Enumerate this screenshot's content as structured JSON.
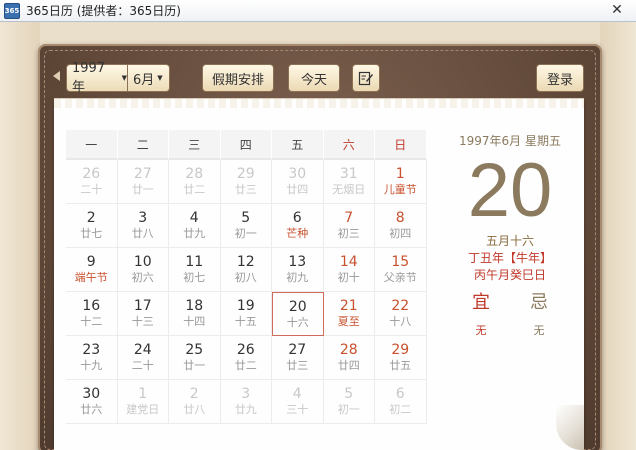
{
  "window": {
    "title": "365日历 (提供者：365日历)",
    "icon_text": "365",
    "close_glyph": "✕"
  },
  "toolbar": {
    "year": "1997 年",
    "month": "6月",
    "holiday_label": "假期安排",
    "today_label": "今天",
    "login_label": "登录"
  },
  "weekdays": [
    "一",
    "二",
    "三",
    "四",
    "五",
    "六",
    "日"
  ],
  "calendar": [
    [
      {
        "day": "26",
        "lunar": "二十"
      },
      {
        "day": "27",
        "lunar": "廿一"
      },
      {
        "day": "28",
        "lunar": "廿二"
      },
      {
        "day": "29",
        "lunar": "廿三"
      },
      {
        "day": "30",
        "lunar": "廿四"
      },
      {
        "day": "31",
        "lunar": "无烟日"
      },
      {
        "day": "1",
        "lunar": "儿童节"
      }
    ],
    [
      {
        "day": "2",
        "lunar": "廿七"
      },
      {
        "day": "3",
        "lunar": "廿八"
      },
      {
        "day": "4",
        "lunar": "廿九"
      },
      {
        "day": "5",
        "lunar": "初一"
      },
      {
        "day": "6",
        "lunar": "芒种"
      },
      {
        "day": "7",
        "lunar": "初三"
      },
      {
        "day": "8",
        "lunar": "初四"
      }
    ],
    [
      {
        "day": "9",
        "lunar": "端午节"
      },
      {
        "day": "10",
        "lunar": "初六"
      },
      {
        "day": "11",
        "lunar": "初七"
      },
      {
        "day": "12",
        "lunar": "初八"
      },
      {
        "day": "13",
        "lunar": "初九"
      },
      {
        "day": "14",
        "lunar": "初十"
      },
      {
        "day": "15",
        "lunar": "父亲节"
      }
    ],
    [
      {
        "day": "16",
        "lunar": "十二"
      },
      {
        "day": "17",
        "lunar": "十三"
      },
      {
        "day": "18",
        "lunar": "十四"
      },
      {
        "day": "19",
        "lunar": "十五"
      },
      {
        "day": "20",
        "lunar": "十六"
      },
      {
        "day": "21",
        "lunar": "夏至"
      },
      {
        "day": "22",
        "lunar": "十八"
      }
    ],
    [
      {
        "day": "23",
        "lunar": "十九"
      },
      {
        "day": "24",
        "lunar": "二十"
      },
      {
        "day": "25",
        "lunar": "廿一"
      },
      {
        "day": "26",
        "lunar": "廿二"
      },
      {
        "day": "27",
        "lunar": "廿三"
      },
      {
        "day": "28",
        "lunar": "廿四"
      },
      {
        "day": "29",
        "lunar": "廿五"
      }
    ],
    [
      {
        "day": "30",
        "lunar": "廿六"
      },
      {
        "day": "1",
        "lunar": "建党日"
      },
      {
        "day": "2",
        "lunar": "廿八"
      },
      {
        "day": "3",
        "lunar": "廿九"
      },
      {
        "day": "4",
        "lunar": "三十"
      },
      {
        "day": "5",
        "lunar": "初一"
      },
      {
        "day": "6",
        "lunar": "初二"
      }
    ]
  ],
  "selected": {
    "date_line": "1997年6月  星期五",
    "big_day": "20",
    "lunar_date": "五月十六",
    "ganzhi_year": "丁丑年【牛年】",
    "ganzhi_month_day": "丙午月癸巳日",
    "yi_label": "宜",
    "ji_label": "忌",
    "yi_value": "无",
    "ji_value": "无"
  },
  "colors": {
    "accent_red": "#c0392b",
    "weekend": "#c8512e",
    "leather": "#5e4637"
  }
}
